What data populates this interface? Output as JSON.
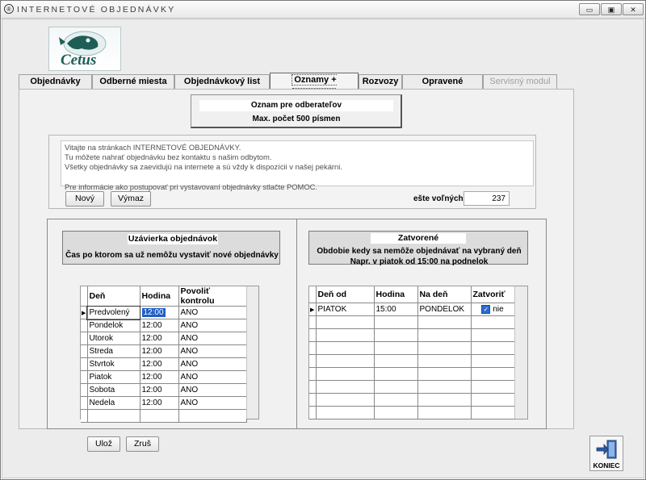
{
  "window": {
    "title": "INTERNETOVÉ OBJEDNÁVKY",
    "icon_letter": "®",
    "buttons": {
      "minimize": "▭",
      "restore": "▣",
      "close": "✕"
    }
  },
  "logo": {
    "text": "Cetus"
  },
  "tabs": [
    {
      "label": "Objednávky"
    },
    {
      "label": "Odberné miesta"
    },
    {
      "label": "Objednávkový list"
    },
    {
      "label": "Oznamy + Uzavierky"
    },
    {
      "label": "Rozvozy"
    },
    {
      "label": "Opravené týždenné"
    },
    {
      "label": "Servisný modul"
    }
  ],
  "notice": {
    "title": "Oznam pre odberateľov",
    "limit": "Max. počet 500 písmen"
  },
  "message": {
    "text": "Vitajte na stránkach INTERNETOVÉ OBJEDNÁVKY.\nTu môžete nahrať objednávku bez kontaktu s našim odbytom.\nVšetky objednávky sa zaevidujú na internete a sú vždy k dispozícii v našej pekárni.\n\nPre informácie ako postupovať pri vystavovaní objednávky stlačte POMOC.",
    "new_label": "Nový",
    "delete_label": "Výmaz",
    "remaining_label": "ešte voľných",
    "remaining_value": "237"
  },
  "closing": {
    "title": "Uzávierka objednávok",
    "description": "Čas po ktorom sa už nemôžu vystaviť nové objednávky",
    "columns": [
      "Deň",
      "Hodina",
      "Povoliť kontrolu"
    ],
    "rows": [
      [
        "Predvolený",
        "12:00",
        "ANO"
      ],
      [
        "Pondelok",
        "12:00",
        "ANO"
      ],
      [
        "Utorok",
        "12:00",
        "ANO"
      ],
      [
        "Streda",
        "12:00",
        "ANO"
      ],
      [
        "Stvrtok",
        "12:00",
        "ANO"
      ],
      [
        "Piatok",
        "12:00",
        "ANO"
      ],
      [
        "Sobota",
        "12:00",
        "ANO"
      ],
      [
        "Nedela",
        "12:00",
        "ANO"
      ]
    ]
  },
  "closed": {
    "title": "Zatvorené",
    "description": "Obdobie kedy sa nemôže objednávať  na vybraný deň",
    "example": "Napr. v piatok od 15:00 na podnelok",
    "columns": [
      "Deň od",
      "Hodina",
      "Na deň",
      "Zatvoriť"
    ],
    "rows": [
      [
        "PIATOK",
        "15:00",
        "PONDELOK",
        "nie"
      ]
    ]
  },
  "footer": {
    "save_label": "Ulož",
    "cancel_label": "Zruš",
    "exit_label": "KONIEC"
  }
}
